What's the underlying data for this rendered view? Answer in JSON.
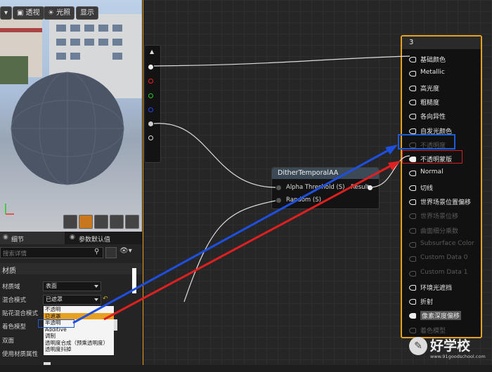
{
  "viewport": {
    "buttons": {
      "perspective": "透视",
      "lit": "光照",
      "show": "显示"
    }
  },
  "details": {
    "tabs": {
      "details": "细节",
      "param_defaults": "参数默认值"
    },
    "search_placeholder": "搜索详情",
    "section": "材质",
    "rows": [
      {
        "label": "材质域",
        "value": "表面"
      },
      {
        "label": "混合模式",
        "value": "已遮罩"
      },
      {
        "label": "贴花混合模式",
        "value": ""
      },
      {
        "label": "着色模型",
        "value": ""
      },
      {
        "label": "双面",
        "value": ""
      },
      {
        "label": "使用材质属性",
        "value": ""
      }
    ],
    "dropdown_options": [
      "不透明",
      "已遮罩",
      "半透明",
      "Additive",
      "调制",
      "透明度合成（预乘透明度）",
      "透明度抖掉"
    ]
  },
  "graph": {
    "node": {
      "title": "DitherTemporalAA",
      "inputs": [
        "Alpha Threshold (S)",
        "Random (S)"
      ],
      "output": "Result"
    },
    "material": {
      "title": "3",
      "pins": [
        "基础颜色",
        "Metallic",
        "高光度",
        "粗糙度",
        "各向异性",
        "自发光颜色",
        "不透明度",
        "不透明蒙版",
        "Normal",
        "切线",
        "世界场景位置偏移",
        "世界场景位移",
        "曲面细分乘数",
        "Subsurface Color",
        "Custom Data 0",
        "Custom Data 1",
        "环境光遮挡",
        "折射",
        "像素深度偏移",
        "着色模型"
      ]
    }
  },
  "watermark": {
    "text": "好学校",
    "url": "www.91goodschool.com"
  }
}
